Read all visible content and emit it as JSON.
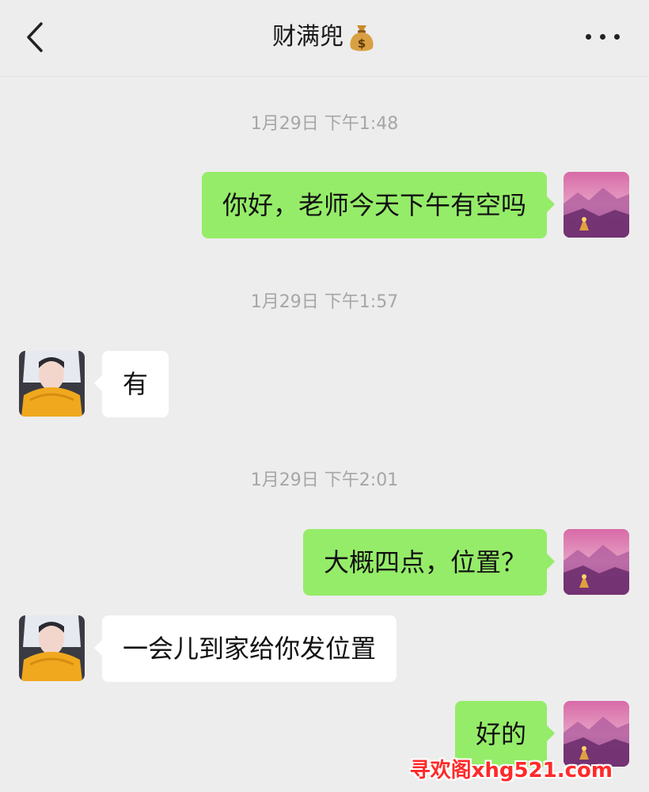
{
  "header": {
    "title": "财满兜",
    "title_emoji": "money-bag-icon",
    "back_icon": "chevron-left-icon",
    "more_icon": "more-dots-icon"
  },
  "messages": [
    {
      "type": "timestamp",
      "text": "1月29日 下午1:48"
    },
    {
      "type": "bubble",
      "side": "me",
      "text": "你好，老师今天下午有空吗"
    },
    {
      "type": "timestamp",
      "text": "1月29日 下午1:57"
    },
    {
      "type": "bubble",
      "side": "other",
      "text": "有"
    },
    {
      "type": "timestamp",
      "text": "1月29日 下午2:01"
    },
    {
      "type": "bubble",
      "side": "me",
      "text": "大概四点，位置？"
    },
    {
      "type": "bubble",
      "side": "other",
      "text": "一会儿到家给你发位置"
    },
    {
      "type": "bubble",
      "side": "me",
      "text": "好的"
    }
  ],
  "watermark": "寻欢阁xhg521.com",
  "colors": {
    "background": "#ededed",
    "my_bubble": "#95ec69",
    "their_bubble": "#ffffff",
    "timestamp_text": "#a6a6a6",
    "watermark": "#ff2a2a"
  }
}
